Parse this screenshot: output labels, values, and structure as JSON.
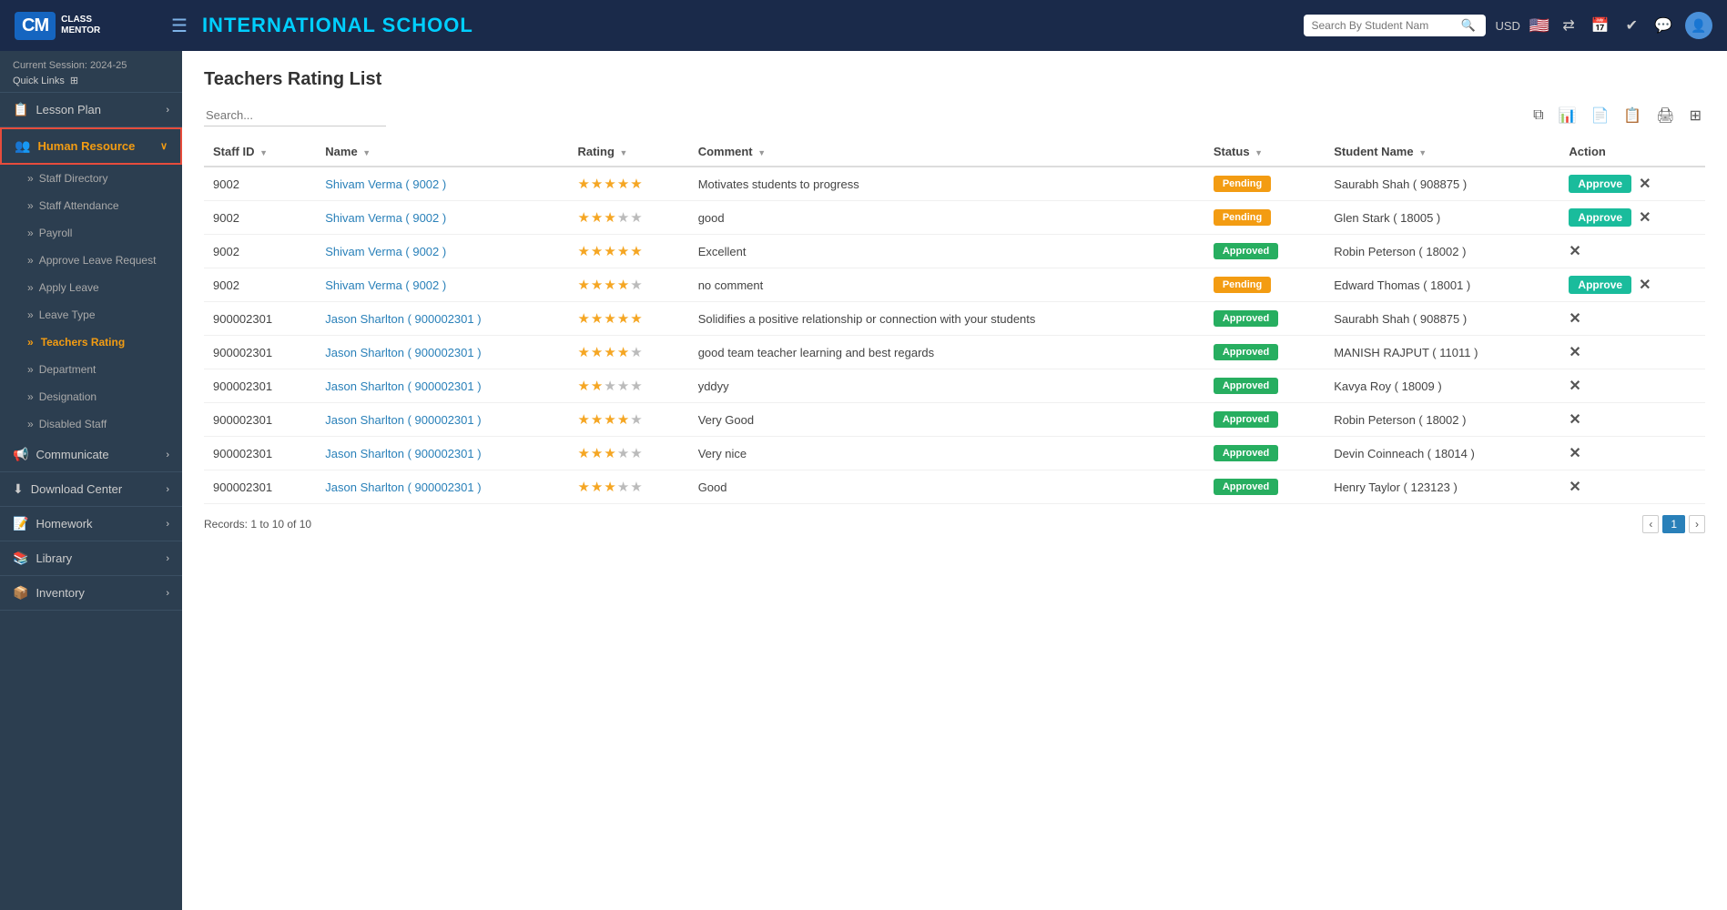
{
  "topnav": {
    "logo_cm": "CM",
    "logo_sub1": "CLASS",
    "logo_sub2": "MENTOR",
    "menu_icon": "☰",
    "school_name": "INTERNATIONAL SCHOOL",
    "search_placeholder": "Search By Student Nam",
    "currency": "USD",
    "flag": "🇺🇸",
    "calendar_icon": "📅",
    "check_icon": "✔",
    "whatsapp_icon": "💬",
    "avatar_icon": "👤"
  },
  "sidebar": {
    "session": "Current Session: 2024-25",
    "quick_links": "Quick Links",
    "quick_links_icon": "⊞",
    "items": [
      {
        "id": "lesson-plan",
        "icon": "📋",
        "label": "Lesson Plan",
        "has_expand": true
      },
      {
        "id": "human-resource",
        "icon": "👥",
        "label": "Human Resource",
        "has_expand": true,
        "active": true,
        "highlighted": true
      },
      {
        "id": "communicate",
        "icon": "📢",
        "label": "Communicate",
        "has_expand": true
      },
      {
        "id": "download-center",
        "icon": "⬇",
        "label": "Download Center",
        "has_expand": true
      },
      {
        "id": "homework",
        "icon": "📝",
        "label": "Homework",
        "has_expand": true
      },
      {
        "id": "library",
        "icon": "📚",
        "label": "Library",
        "has_expand": true
      },
      {
        "id": "inventory",
        "icon": "📦",
        "label": "Inventory",
        "has_expand": true
      }
    ],
    "sub_items": [
      {
        "id": "staff-directory",
        "label": "Staff Directory"
      },
      {
        "id": "staff-attendance",
        "label": "Staff Attendance"
      },
      {
        "id": "payroll",
        "label": "Payroll"
      },
      {
        "id": "approve-leave",
        "label": "Approve Leave Request"
      },
      {
        "id": "apply-leave",
        "label": "Apply Leave"
      },
      {
        "id": "leave-type",
        "label": "Leave Type"
      },
      {
        "id": "teachers-rating",
        "label": "Teachers Rating",
        "active": true
      },
      {
        "id": "department",
        "label": "Department"
      },
      {
        "id": "designation",
        "label": "Designation"
      },
      {
        "id": "disabled-staff",
        "label": "Disabled Staff"
      }
    ]
  },
  "page": {
    "title": "Teachers Rating List",
    "search_placeholder": "Search...",
    "records_text": "Records: 1 to 10 of 10"
  },
  "table": {
    "columns": [
      {
        "id": "staff-id",
        "label": "Staff ID"
      },
      {
        "id": "name",
        "label": "Name"
      },
      {
        "id": "rating",
        "label": "Rating"
      },
      {
        "id": "comment",
        "label": "Comment"
      },
      {
        "id": "status",
        "label": "Status"
      },
      {
        "id": "student-name",
        "label": "Student Name"
      },
      {
        "id": "action",
        "label": "Action"
      }
    ],
    "rows": [
      {
        "staff_id": "9002",
        "name": "Shivam Verma ( 9002 )",
        "rating": 5,
        "comment": "Motivates students to progress",
        "status": "Pending",
        "status_type": "pending",
        "student_name": "Saurabh Shah ( 908875 )",
        "has_approve": true
      },
      {
        "staff_id": "9002",
        "name": "Shivam Verma ( 9002 )",
        "rating": 3,
        "comment": "good",
        "status": "Pending",
        "status_type": "pending",
        "student_name": "Glen Stark ( 18005 )",
        "has_approve": true
      },
      {
        "staff_id": "9002",
        "name": "Shivam Verma ( 9002 )",
        "rating": 5,
        "comment": "Excellent",
        "status": "Approved",
        "status_type": "approved",
        "student_name": "Robin Peterson ( 18002 )",
        "has_approve": false
      },
      {
        "staff_id": "9002",
        "name": "Shivam Verma ( 9002 )",
        "rating": 4,
        "comment": "no comment",
        "status": "Pending",
        "status_type": "pending",
        "student_name": "Edward Thomas ( 18001 )",
        "has_approve": true
      },
      {
        "staff_id": "900002301",
        "name": "Jason Sharlton ( 900002301 )",
        "rating": 5,
        "comment": "Solidifies a positive relationship or connection with your students",
        "status": "Approved",
        "status_type": "approved",
        "student_name": "Saurabh Shah ( 908875 )",
        "has_approve": false
      },
      {
        "staff_id": "900002301",
        "name": "Jason Sharlton ( 900002301 )",
        "rating": 4,
        "comment": "good team teacher learning and best regards",
        "status": "Approved",
        "status_type": "approved",
        "student_name": "MANISH RAJPUT ( 11011 )",
        "has_approve": false
      },
      {
        "staff_id": "900002301",
        "name": "Jason Sharlton ( 900002301 )",
        "rating": 2,
        "comment": "yddyy",
        "status": "Approved",
        "status_type": "approved",
        "student_name": "Kavya Roy ( 18009 )",
        "has_approve": false
      },
      {
        "staff_id": "900002301",
        "name": "Jason Sharlton ( 900002301 )",
        "rating": 4,
        "comment": "Very Good",
        "status": "Approved",
        "status_type": "approved",
        "student_name": "Robin Peterson ( 18002 )",
        "has_approve": false
      },
      {
        "staff_id": "900002301",
        "name": "Jason Sharlton ( 900002301 )",
        "rating": 3,
        "comment": "Very nice",
        "status": "Approved",
        "status_type": "approved",
        "student_name": "Devin Coinneach ( 18014 )",
        "has_approve": false
      },
      {
        "staff_id": "900002301",
        "name": "Jason Sharlton ( 900002301 )",
        "rating": 3,
        "comment": "Good",
        "status": "Approved",
        "status_type": "approved",
        "student_name": "Henry Taylor ( 123123 )",
        "has_approve": false
      }
    ]
  },
  "pagination": {
    "current": 1,
    "total": 1
  },
  "icons": {
    "copy": "⧉",
    "export1": "📊",
    "export2": "📄",
    "export3": "📋",
    "print": "🖨",
    "grid": "⊞"
  }
}
